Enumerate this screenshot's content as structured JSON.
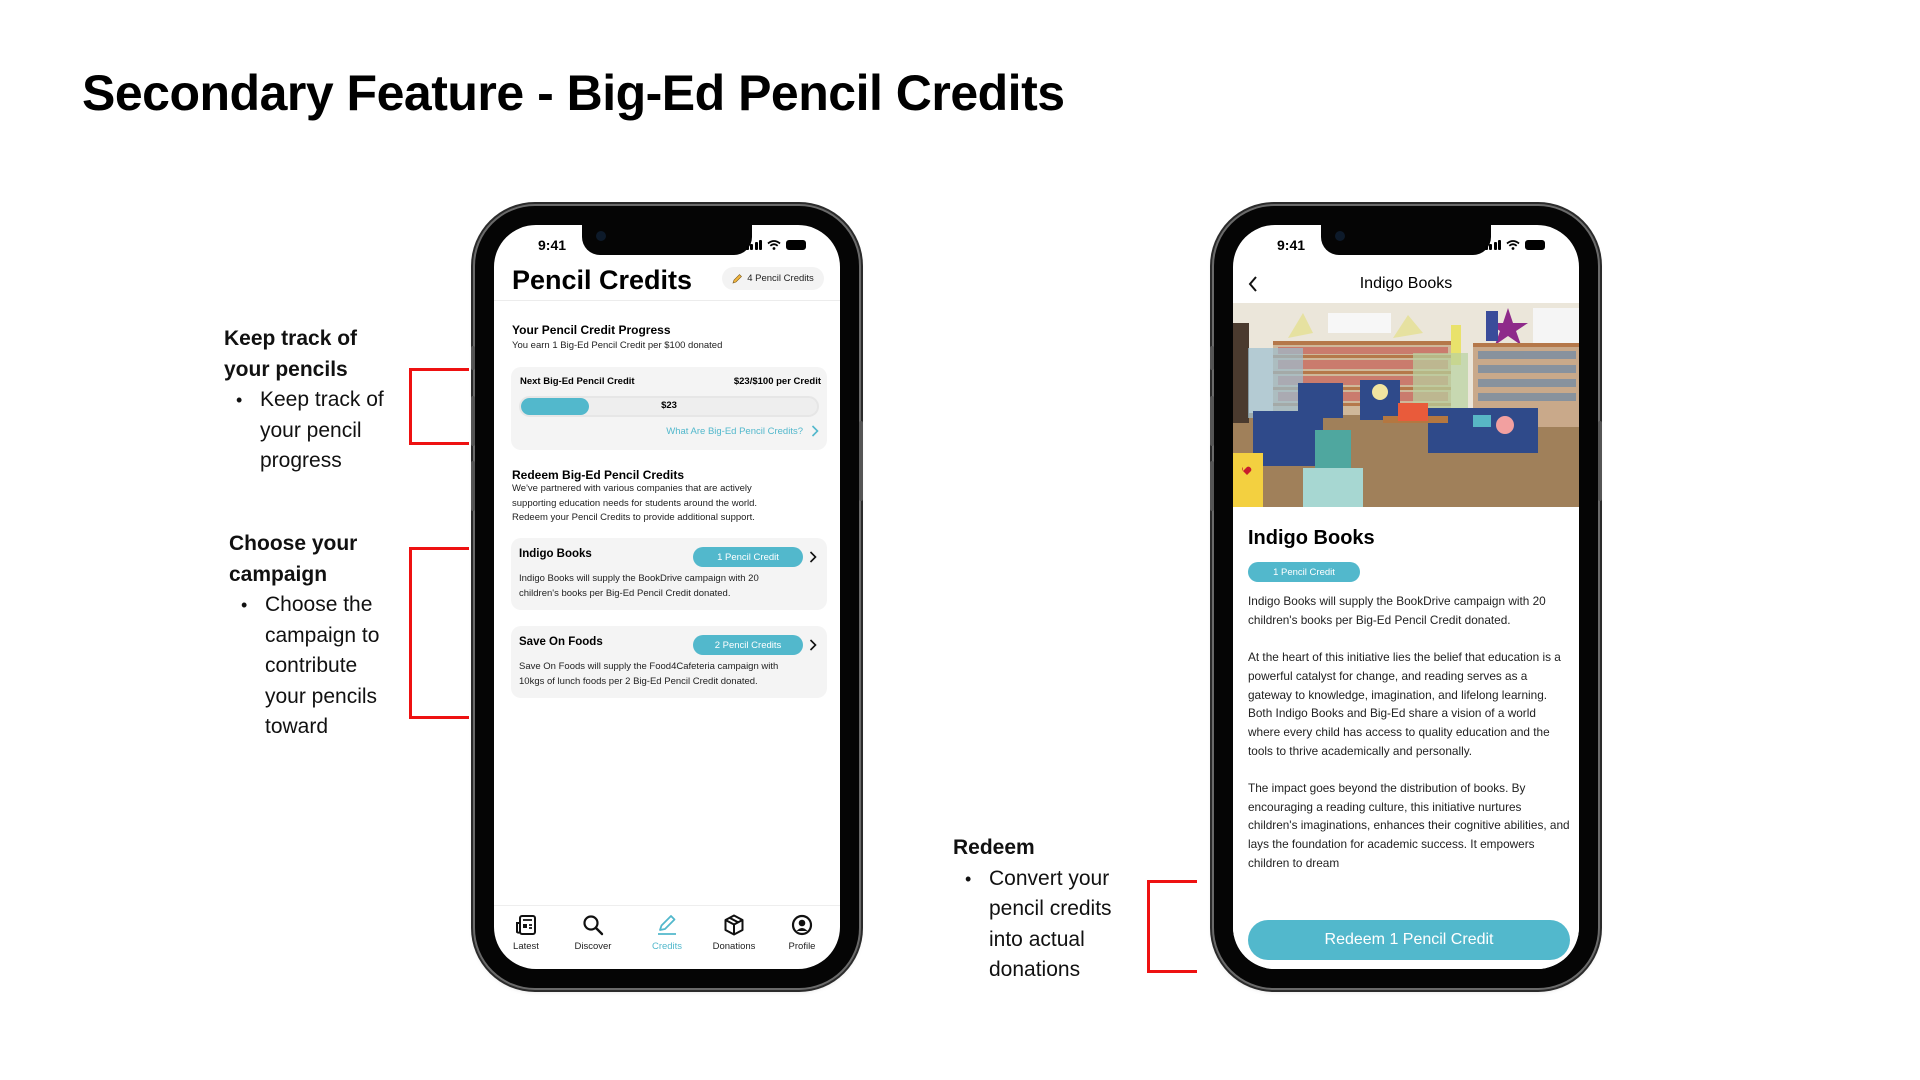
{
  "page_title": "Secondary Feature - Big-Ed Pencil Credits",
  "annotations": [
    {
      "heading_lines": [
        "Keep track of",
        "your pencils"
      ],
      "bullet_lines": [
        "Keep track of",
        "your pencil",
        "progress"
      ]
    },
    {
      "heading_lines": [
        "Choose your",
        "campaign"
      ],
      "bullet_lines": [
        "Choose the",
        "campaign to",
        "contribute",
        "your pencils",
        "toward"
      ]
    },
    {
      "heading_lines": [
        "Redeem"
      ],
      "bullet_lines": [
        "Convert your",
        "pencil credits",
        "into actual",
        "donations"
      ]
    }
  ],
  "colors": {
    "accent": "#52b8cc",
    "annotation_red": "#ee1111"
  },
  "status_bar": {
    "time": "9:41"
  },
  "credits_screen": {
    "title": "Pencil Credits",
    "balance_badge": "4 Pencil Credits",
    "progress_section": {
      "heading": "Your Pencil Credit Progress",
      "subtitle": "You earn 1 Big-Ed Pencil Credit per $100 donated",
      "card_label": "Next Big-Ed Pencil Credit",
      "card_amount": "$23/$100 per Credit",
      "bar_value_label": "$23",
      "progress_fraction": 0.23,
      "link": "What Are Big-Ed Pencil Credits?"
    },
    "redeem_section": {
      "heading": "Redeem Big-Ed Pencil Credits",
      "description_lines": [
        "We've partnered with various companies that are actively",
        "supporting education needs for students around the world.",
        "Redeem your Pencil Credits to provide additional support."
      ]
    },
    "campaigns": [
      {
        "name": "Indigo Books",
        "cost": "1 Pencil Credit",
        "description_lines": [
          "Indigo Books will supply the BookDrive campaign with 20",
          "children's books per Big-Ed Pencil Credit donated."
        ]
      },
      {
        "name": "Save On Foods",
        "cost": "2 Pencil Credits",
        "description_lines": [
          "Save On Foods will supply the Food4Cafeteria campaign with",
          "10kgs of lunch foods per 2 Big-Ed Pencil Credit donated."
        ]
      }
    ],
    "tabs": [
      {
        "label": "Latest",
        "icon": "newspaper-icon",
        "active": false
      },
      {
        "label": "Discover",
        "icon": "search-icon",
        "active": false
      },
      {
        "label": "Credits",
        "icon": "pencil-icon",
        "active": true
      },
      {
        "label": "Donations",
        "icon": "box-icon",
        "active": false
      },
      {
        "label": "Profile",
        "icon": "profile-icon",
        "active": false
      }
    ]
  },
  "detail_screen": {
    "nav_title": "Indigo Books",
    "hero_image": "library reading corner with blue sofas and bookshelves",
    "title": "Indigo Books",
    "cost_badge": "1 Pencil Credit",
    "paragraphs": [
      "Indigo Books will supply the BookDrive campaign with 20 children's books per Big-Ed Pencil Credit donated.",
      "At the heart of this initiative lies the belief that education is a powerful catalyst for change, and reading serves as a gateway to knowledge, imagination, and lifelong learning. Both Indigo Books and Big-Ed share a vision of a world where every child has access to quality education and the tools to thrive academically and personally.",
      "The impact goes beyond the distribution of books. By encouraging a reading culture, this initiative nurtures children's imaginations, enhances their cognitive abilities, and lays the foundation for academic success. It empowers children to dream"
    ],
    "redeem_button": "Redeem 1 Pencil Credit"
  }
}
